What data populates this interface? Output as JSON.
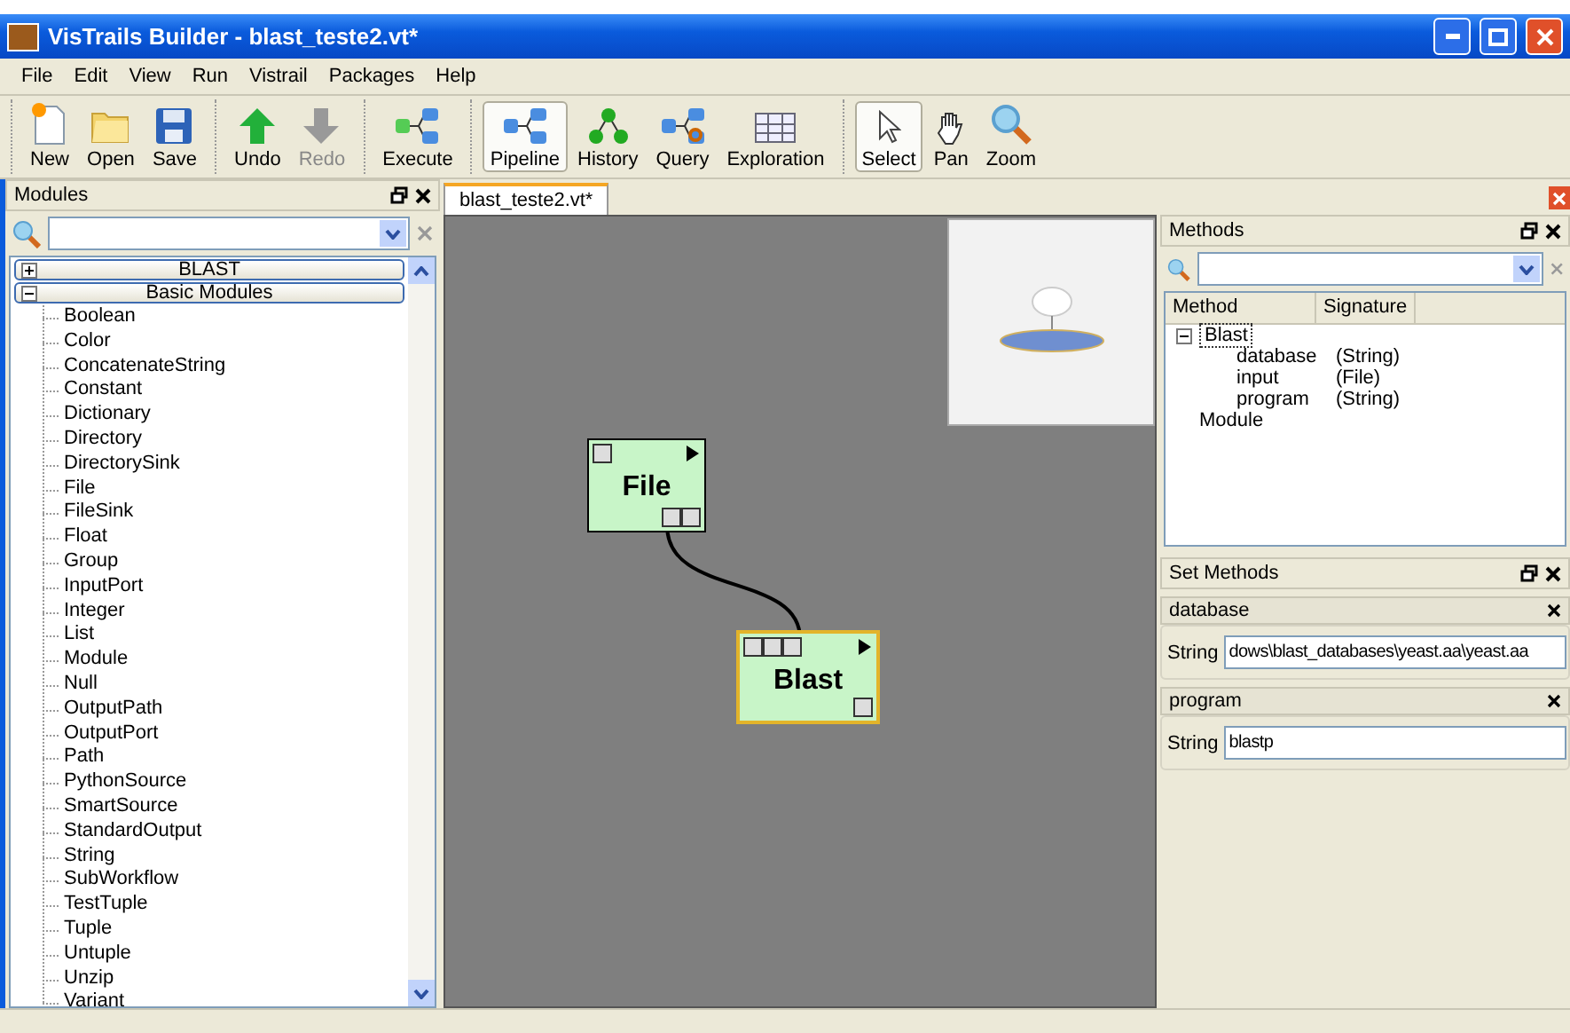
{
  "window": {
    "title": "VisTrails Builder - blast_teste2.vt*"
  },
  "menu": [
    "File",
    "Edit",
    "View",
    "Run",
    "Vistrail",
    "Packages",
    "Help"
  ],
  "toolbar": [
    [
      {
        "label": "New",
        "kind": "new",
        "selected": false,
        "disabled": false
      },
      {
        "label": "Open",
        "kind": "open",
        "selected": false,
        "disabled": false
      },
      {
        "label": "Save",
        "kind": "save",
        "selected": false,
        "disabled": false
      }
    ],
    [
      {
        "label": "Undo",
        "kind": "undo",
        "selected": false,
        "disabled": false
      },
      {
        "label": "Redo",
        "kind": "redo",
        "selected": false,
        "disabled": true
      }
    ],
    [
      {
        "label": "Execute",
        "kind": "execute",
        "selected": false,
        "disabled": false
      }
    ],
    [
      {
        "label": "Pipeline",
        "kind": "pipeline",
        "selected": true,
        "disabled": false
      },
      {
        "label": "History",
        "kind": "history",
        "selected": false,
        "disabled": false
      },
      {
        "label": "Query",
        "kind": "query",
        "selected": false,
        "disabled": false
      },
      {
        "label": "Exploration",
        "kind": "exploration",
        "selected": false,
        "disabled": false
      }
    ],
    [
      {
        "label": "Select",
        "kind": "select",
        "selected": true,
        "disabled": false
      },
      {
        "label": "Pan",
        "kind": "pan",
        "selected": false,
        "disabled": false
      },
      {
        "label": "Zoom",
        "kind": "zoom",
        "selected": false,
        "disabled": false
      }
    ]
  ],
  "modules_panel": {
    "title": "Modules",
    "packages": [
      {
        "label": "BLAST",
        "expanded": false
      },
      {
        "label": "Basic Modules",
        "expanded": true,
        "items": [
          "Boolean",
          "Color",
          "ConcatenateString",
          "Constant",
          "Dictionary",
          "Directory",
          "DirectorySink",
          "File",
          "FileSink",
          "Float",
          "Group",
          "InputPort",
          "Integer",
          "List",
          "Module",
          "Null",
          "OutputPath",
          "OutputPort",
          "Path",
          "PythonSource",
          "SmartSource",
          "StandardOutput",
          "String",
          "SubWorkflow",
          "TestTuple",
          "Tuple",
          "Untuple",
          "Unzip",
          "Variant"
        ]
      }
    ]
  },
  "tabs": [
    {
      "label": "blast_teste2.vt*",
      "selected": true
    }
  ],
  "pipeline": {
    "modules": [
      {
        "name": "File",
        "selected": false
      },
      {
        "name": "Blast",
        "selected": true
      }
    ]
  },
  "methods_panel": {
    "title": "Methods",
    "columns": [
      "Method",
      "Signature"
    ],
    "tree": [
      {
        "method": "Blast",
        "expanded": true,
        "children": [
          {
            "method": "database",
            "signature": "(String)"
          },
          {
            "method": "input",
            "signature": "(File)"
          },
          {
            "method": "program",
            "signature": "(String)"
          }
        ]
      },
      {
        "method": "Module"
      }
    ]
  },
  "set_methods": {
    "title": "Set Methods",
    "params": [
      {
        "name": "database",
        "type": "String",
        "value": "dows\\blast_databases\\yeast.aa\\yeast.aa"
      },
      {
        "name": "program",
        "type": "String",
        "value": "blastp"
      }
    ]
  }
}
